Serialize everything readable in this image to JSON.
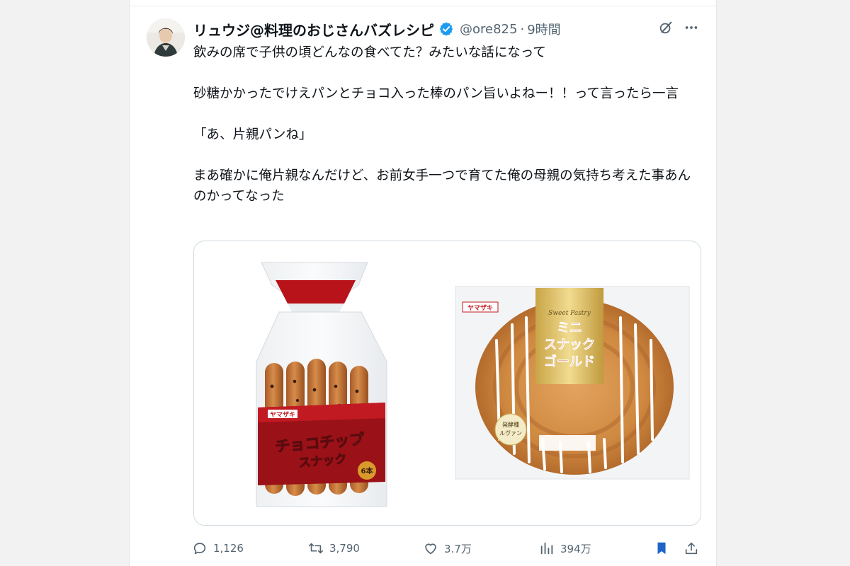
{
  "tweet": {
    "display_name": "リュウジ@料理のおじさんバズレシピ",
    "handle": "@ore825",
    "separator": "·",
    "time": "9時間",
    "text_lines": [
      "飲みの席で子供の頃どんなの食べてた？みたいな話になって",
      "",
      "砂糖かかったでけえパンとチョコ入った棒のパン旨いよねー！！って言ったら一言",
      "",
      "「あ、片親パンね」",
      "",
      "まあ確かに俺片親なんだけど、お前女手一つで育てた俺の母親の気持ち考えた事あんのかってなった"
    ]
  },
  "media": {
    "left": {
      "brand": "ヤマザキ",
      "product_line1": "チョコチップ",
      "product_line2": "スナック",
      "count": "6本"
    },
    "right": {
      "brand": "ヤマザキ",
      "script": "Sweet Pastry",
      "product_line1": "ミニ",
      "product_line2": "スナック",
      "product_line3": "ゴールド",
      "badge_line1": "発酵種",
      "badge_line2": "ルヴァン"
    }
  },
  "actions": {
    "replies": "1,126",
    "retweets": "3,790",
    "likes": "3.7万",
    "views": "394万"
  },
  "colors": {
    "accent": "#1d9bf0",
    "muted": "#536471",
    "text": "#0f1419",
    "bookmark": "#1d64c8"
  },
  "icons": {
    "verified": "verified-badge-icon",
    "grok": "grok-icon",
    "more": "more-icon",
    "reply": "reply-icon",
    "retweet": "retweet-icon",
    "like": "heart-icon",
    "views": "views-icon",
    "bookmark": "bookmark-icon",
    "share": "share-icon"
  }
}
